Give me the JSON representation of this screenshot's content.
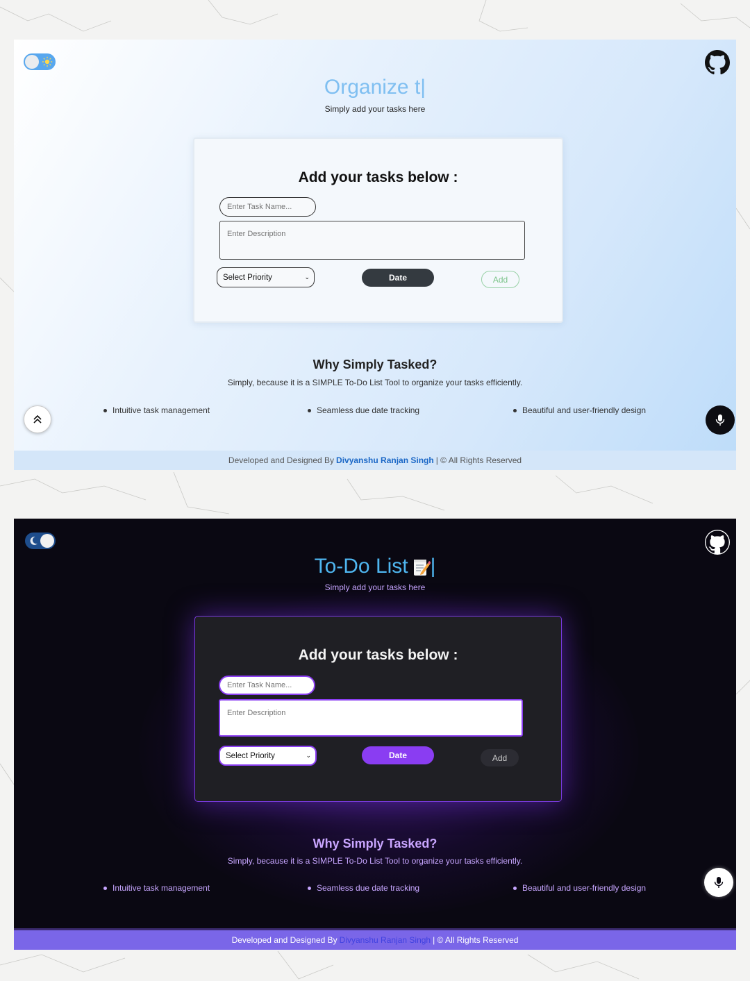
{
  "light": {
    "hero_title": "Organize t|",
    "hero_subtitle": "Simply add your tasks here",
    "card_title": "Add your tasks below :",
    "task_name_placeholder": "Enter Task Name...",
    "description_placeholder": "Enter Description",
    "priority_selected": "Select Priority",
    "date_label": "Date",
    "add_label": "Add",
    "why_title": "Why Simply Tasked?",
    "why_subtitle": "Simply, because it is a SIMPLE To-Do List Tool to organize your tasks efficiently.",
    "features": [
      "Intuitive task management",
      "Seamless due date tracking",
      "Beautiful and user-friendly design"
    ],
    "footer_prefix": "Developed and Designed By",
    "footer_author": "Divyanshu Ranjan Singh",
    "footer_suffix": "| © All Rights Reserved"
  },
  "dark": {
    "hero_title": "To-Do List",
    "hero_cursor": "|",
    "hero_subtitle": "Simply add your tasks here",
    "card_title": "Add your tasks below :",
    "task_name_placeholder": "Enter Task Name...",
    "description_placeholder": "Enter Description",
    "priority_selected": "Select Priority",
    "date_label": "Date",
    "add_label": "Add",
    "why_title": "Why Simply Tasked?",
    "why_subtitle": "Simply, because it is a SIMPLE To-Do List Tool to organize your tasks efficiently.",
    "features": [
      "Intuitive task management",
      "Seamless due date tracking",
      "Beautiful and user-friendly design"
    ],
    "footer_prefix": "Developed and Designed By",
    "footer_author": "Divyanshu Ranjan Singh",
    "footer_suffix": "| © All Rights Reserved"
  },
  "icons": {
    "theme_toggle_light": "sun-icon",
    "theme_toggle_dark": "moon-icon",
    "github": "github-icon",
    "scroll_top": "chevron-double-up-icon",
    "microphone": "microphone-icon",
    "title_emoji": "memo-icon"
  },
  "colors": {
    "light_title": "#7fbff1",
    "light_date_button": "#343a40",
    "light_add_button": "#7cc48a",
    "light_author_link": "#1a67c6",
    "dark_title": "#4fb6f0",
    "dark_accent": "#8a3df2",
    "dark_text": "#c7a6ff",
    "dark_footer": "#7a66e8"
  }
}
